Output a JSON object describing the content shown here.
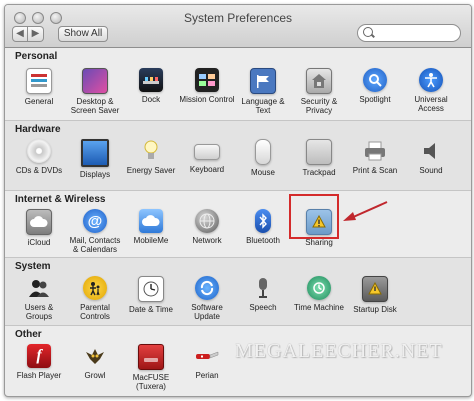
{
  "window": {
    "title": "System Preferences"
  },
  "toolbar": {
    "show_all_label": "Show All",
    "back_glyph": "◀",
    "forward_glyph": "▶",
    "search_placeholder": ""
  },
  "sections": {
    "personal": {
      "label": "Personal",
      "items": [
        {
          "label": "General",
          "icon": "general-icon"
        },
        {
          "label": "Desktop & Screen Saver",
          "icon": "desktop-icon"
        },
        {
          "label": "Dock",
          "icon": "dock-icon"
        },
        {
          "label": "Mission Control",
          "icon": "mission-control-icon"
        },
        {
          "label": "Language & Text",
          "icon": "flag-icon"
        },
        {
          "label": "Security & Privacy",
          "icon": "house-lock-icon"
        },
        {
          "label": "Spotlight",
          "icon": "spotlight-icon"
        },
        {
          "label": "Universal Access",
          "icon": "universal-access-icon"
        }
      ]
    },
    "hardware": {
      "label": "Hardware",
      "items": [
        {
          "label": "CDs & DVDs",
          "icon": "disc-icon"
        },
        {
          "label": "Displays",
          "icon": "display-icon"
        },
        {
          "label": "Energy Saver",
          "icon": "bulb-icon"
        },
        {
          "label": "Keyboard",
          "icon": "keyboard-icon"
        },
        {
          "label": "Mouse",
          "icon": "mouse-icon"
        },
        {
          "label": "Trackpad",
          "icon": "trackpad-icon"
        },
        {
          "label": "Print & Scan",
          "icon": "printer-icon"
        },
        {
          "label": "Sound",
          "icon": "speaker-icon"
        }
      ]
    },
    "internet": {
      "label": "Internet & Wireless",
      "items": [
        {
          "label": "iCloud",
          "icon": "cloud-icon"
        },
        {
          "label": "Mail, Contacts & Calendars",
          "icon": "at-icon"
        },
        {
          "label": "MobileMe",
          "icon": "mobileme-icon"
        },
        {
          "label": "Network",
          "icon": "globe-icon"
        },
        {
          "label": "Bluetooth",
          "icon": "bluetooth-icon"
        },
        {
          "label": "Sharing",
          "icon": "shared-folder-icon"
        }
      ]
    },
    "system": {
      "label": "System",
      "items": [
        {
          "label": "Users & Groups",
          "icon": "users-icon"
        },
        {
          "label": "Parental Controls",
          "icon": "parental-icon"
        },
        {
          "label": "Date & Time",
          "icon": "clock-icon"
        },
        {
          "label": "Software Update",
          "icon": "update-icon"
        },
        {
          "label": "Speech",
          "icon": "microphone-icon"
        },
        {
          "label": "Time Machine",
          "icon": "time-machine-icon"
        },
        {
          "label": "Startup Disk",
          "icon": "hard-disk-icon"
        }
      ]
    },
    "other": {
      "label": "Other",
      "items": [
        {
          "label": "Flash Player",
          "icon": "flash-icon"
        },
        {
          "label": "Growl",
          "icon": "growl-icon"
        },
        {
          "label": "MacFUSE (Tuxera)",
          "icon": "drive-icon"
        },
        {
          "label": "Perian",
          "icon": "knife-icon"
        }
      ]
    }
  },
  "watermark": "MEGALEECHER.NET",
  "colors": {
    "highlight": "#d42b2b",
    "arrow": "#c0272d"
  }
}
